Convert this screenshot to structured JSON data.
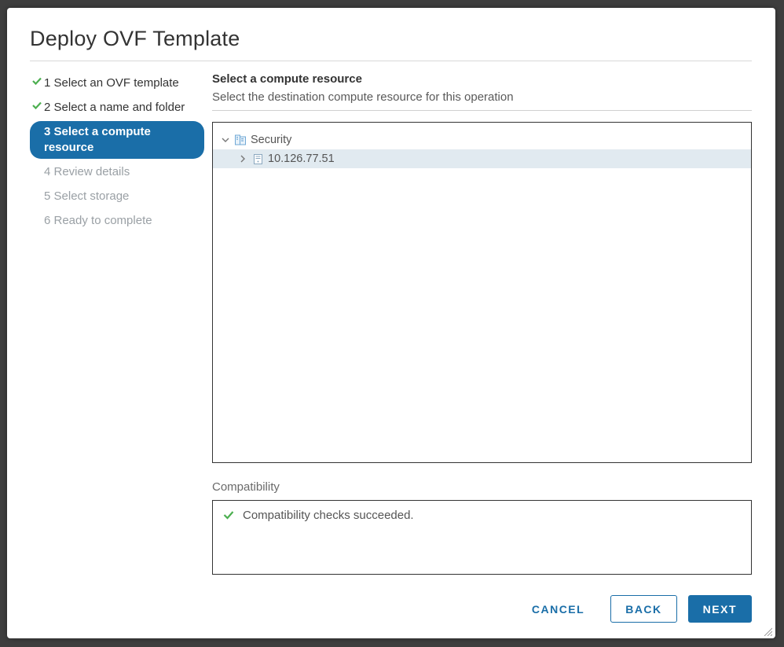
{
  "dialog": {
    "title": "Deploy OVF Template"
  },
  "steps": {
    "items": [
      {
        "label": "1 Select an OVF template",
        "state": "done"
      },
      {
        "label": "2 Select a name and folder",
        "state": "done"
      },
      {
        "label": "3 Select a compute resource",
        "state": "current"
      },
      {
        "label": "4 Review details",
        "state": "future"
      },
      {
        "label": "5 Select storage",
        "state": "future"
      },
      {
        "label": "6 Ready to complete",
        "state": "future"
      }
    ]
  },
  "content": {
    "heading": "Select a compute resource",
    "subheading": "Select the destination compute resource for this operation",
    "tree": {
      "items": [
        {
          "label": "Security",
          "indent": 0,
          "expanded": true,
          "selected": false,
          "icon": "datacenter-icon"
        },
        {
          "label": "10.126.77.51",
          "indent": 1,
          "expanded": false,
          "selected": true,
          "icon": "host-icon"
        }
      ]
    },
    "compat_label": "Compatibility",
    "compat_message": "Compatibility checks succeeded."
  },
  "footer": {
    "cancel": "CANCEL",
    "back": "BACK",
    "next": "NEXT"
  }
}
